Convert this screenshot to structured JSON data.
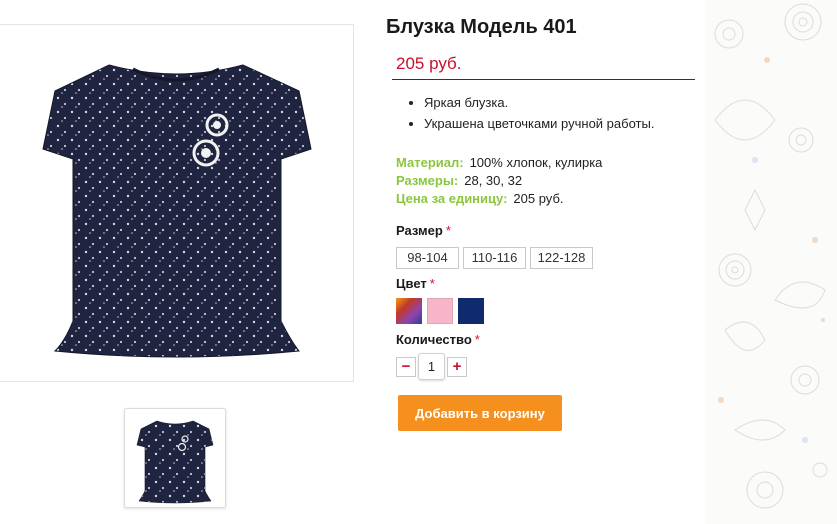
{
  "product": {
    "title": "Блузка Модель 401",
    "price": "205 руб."
  },
  "features": [
    "Яркая блузка.",
    "Украшена цветочками ручной работы."
  ],
  "specs": [
    {
      "label": "Материал:",
      "value": "100% хлопок, кулирка"
    },
    {
      "label": "Размеры:",
      "value": "28, 30, 32"
    },
    {
      "label": "Цена за единицу:",
      "value": "205 руб."
    }
  ],
  "options": {
    "size": {
      "label": "Размер",
      "required_mark": "*",
      "values": [
        "98-104",
        "110-116",
        "122-128"
      ]
    },
    "color": {
      "label": "Цвет",
      "required_mark": "*",
      "swatches": [
        {
          "name": "multicolor",
          "colors": [
            "#f39c12",
            "#c0392b",
            "#8e44ad",
            "#2c3e9e"
          ]
        },
        {
          "name": "pink",
          "colors": [
            "#f7b6c8"
          ]
        },
        {
          "name": "navy",
          "colors": [
            "#102a6e"
          ]
        }
      ]
    },
    "quantity": {
      "label": "Количество",
      "required_mark": "*",
      "value": "1",
      "minus_symbol": "−",
      "plus_symbol": "+"
    }
  },
  "actions": {
    "add_to_cart": "Добавить в корзину"
  },
  "images": {
    "main": "blouse-photo",
    "thumbnail": "blouse-thumbnail"
  },
  "theme": {
    "accent_red": "#c8102e",
    "label_green": "#8cc63f",
    "button_orange": "#f5901e",
    "blouse_navy": "#1f2440"
  }
}
